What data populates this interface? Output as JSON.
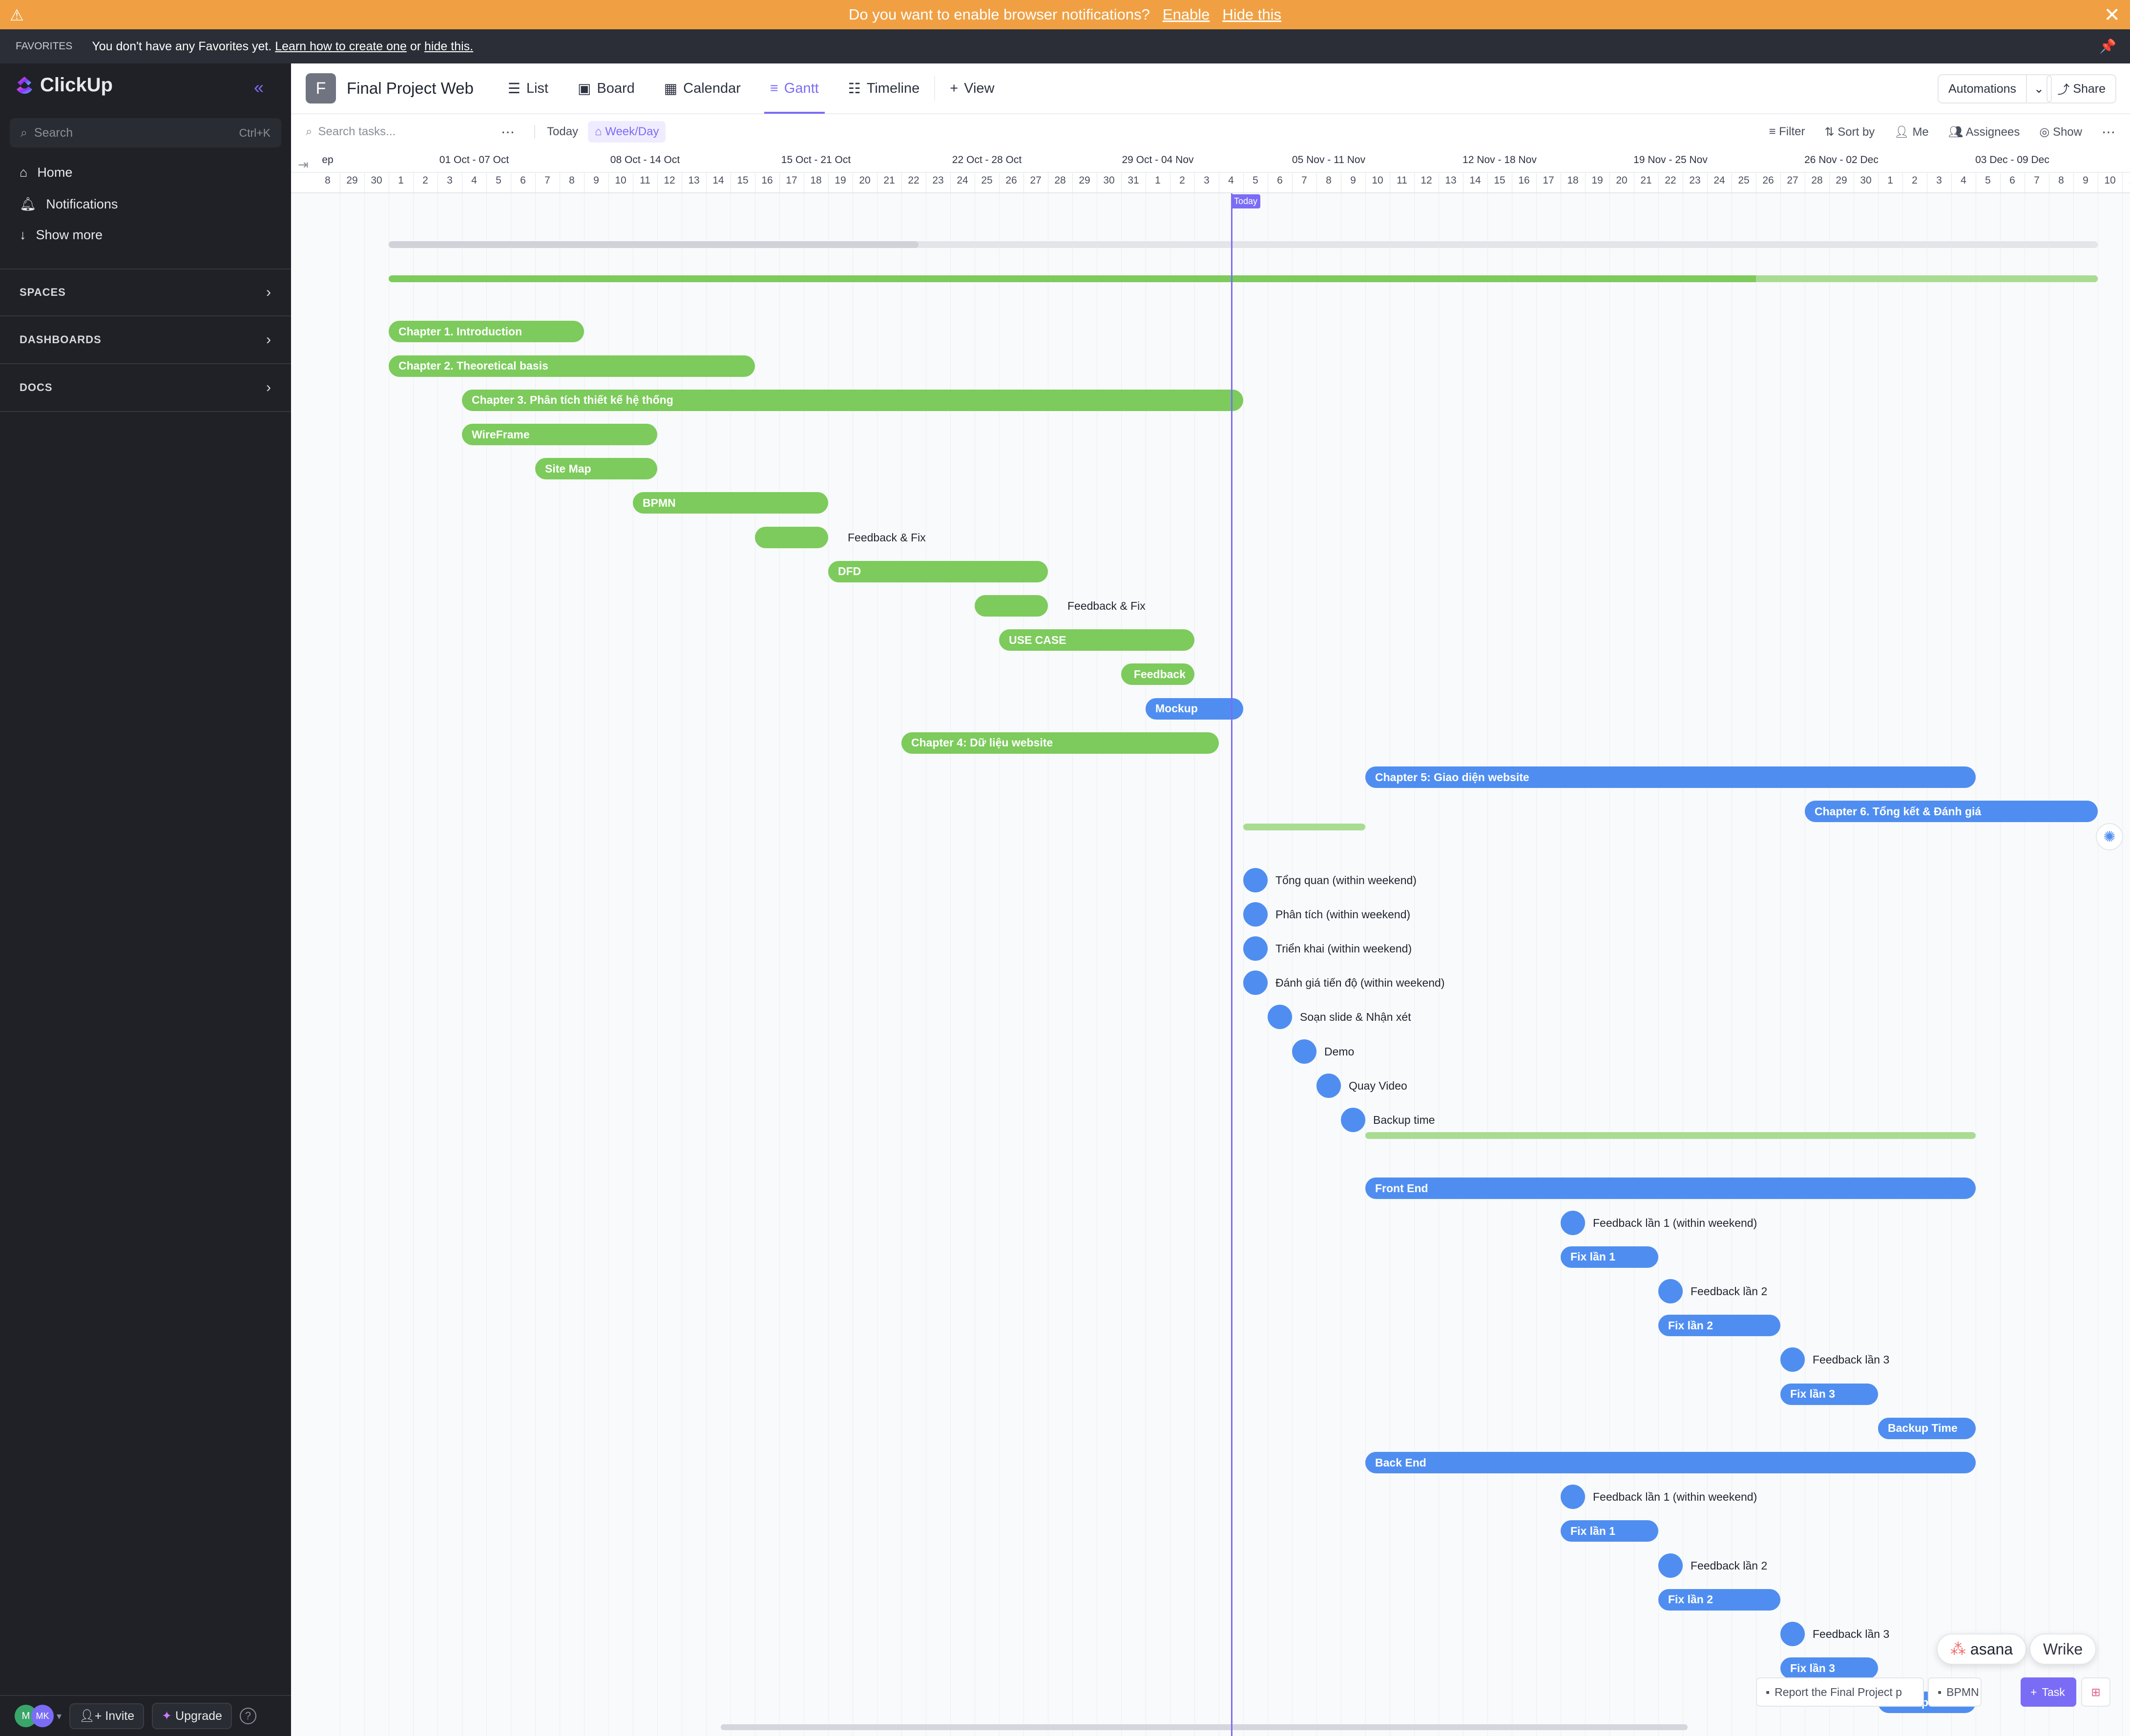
{
  "notification": {
    "prompt": "Do you want to enable browser notifications?",
    "enable": "Enable",
    "hide": "Hide this"
  },
  "favorites": {
    "label": "FAVORITES",
    "text": "You don't have any Favorites yet.",
    "link1": "Learn how to create one",
    "or": "or",
    "link2": "hide this."
  },
  "sidebar": {
    "brand": "ClickUp",
    "search_placeholder": "Search",
    "search_shortcut": "Ctrl+K",
    "nav": [
      "Home",
      "Notifications",
      "Show more"
    ],
    "sections": [
      "SPACES",
      "DASHBOARDS",
      "DOCS"
    ],
    "invite": "Invite",
    "upgrade": "Upgrade",
    "avatar1": "M",
    "avatar2": "MK"
  },
  "header": {
    "project_initial": "F",
    "project_title": "Final Project Web",
    "tabs": [
      "List",
      "Board",
      "Calendar",
      "Gantt",
      "Timeline"
    ],
    "add_view": "View",
    "automations": "Automations",
    "share": "Share"
  },
  "toolbar": {
    "search_placeholder": "Search tasks...",
    "today": "Today",
    "scale": "Week/Day",
    "filter": "Filter",
    "sort": "Sort by",
    "me": "Me",
    "assignees": "Assignees",
    "show": "Show"
  },
  "gantt": {
    "weeks": [
      "ep",
      "01 Oct - 07 Oct",
      "08 Oct - 14 Oct",
      "15 Oct - 21 Oct",
      "22 Oct - 28 Oct",
      "29 Oct - 04 Nov",
      "05 Nov - 11 Nov",
      "12 Nov - 18 Nov",
      "19 Nov - 25 Nov",
      "26 Nov - 02 Dec",
      "03 Dec - 09 Dec"
    ],
    "days": [
      "8",
      "29",
      "30",
      "1",
      "2",
      "3",
      "4",
      "5",
      "6",
      "7",
      "8",
      "9",
      "10",
      "11",
      "12",
      "13",
      "14",
      "15",
      "16",
      "17",
      "18",
      "19",
      "20",
      "21",
      "22",
      "23",
      "24",
      "25",
      "26",
      "27",
      "28",
      "29",
      "30",
      "31",
      "1",
      "2",
      "3",
      "4",
      "5",
      "6",
      "7",
      "8",
      "9",
      "10",
      "11",
      "12",
      "13",
      "14",
      "15",
      "16",
      "17",
      "18",
      "19",
      "20",
      "21",
      "22",
      "23",
      "24",
      "25",
      "26",
      "27",
      "28",
      "29",
      "30",
      "1",
      "2",
      "3",
      "4",
      "5",
      "6",
      "7",
      "8",
      "9",
      "10",
      "11"
    ],
    "today_label": "Today",
    "today_day": 37.5,
    "tasks": [
      {
        "type": "summary",
        "start": 3,
        "end": 73,
        "color": "#e3e5e9"
      },
      {
        "type": "summary",
        "start": 3,
        "end": 73,
        "color": "#7ccb5c",
        "progress": 0.8
      },
      {
        "type": "bar",
        "name": "Chapter 1. Introduction",
        "start": 3,
        "end": 11,
        "color": "green"
      },
      {
        "type": "bar",
        "name": "Chapter 2. Theoretical basis",
        "start": 3,
        "end": 18,
        "color": "green"
      },
      {
        "type": "bar",
        "name": "Chapter 3. Phân tích thiết kế hệ thống",
        "start": 6,
        "end": 38,
        "color": "green"
      },
      {
        "type": "bar",
        "name": "WireFrame",
        "start": 6,
        "end": 14,
        "color": "green"
      },
      {
        "type": "bar",
        "name": "Site Map",
        "start": 9,
        "end": 14,
        "color": "green"
      },
      {
        "type": "bar",
        "name": "BPMN",
        "start": 13,
        "end": 21,
        "color": "green"
      },
      {
        "type": "bar",
        "name": "Feedback & Fix",
        "label": "outside",
        "start": 18,
        "end": 21,
        "color": "green"
      },
      {
        "type": "bar",
        "name": "DFD",
        "start": 21,
        "end": 30,
        "color": "green"
      },
      {
        "type": "bar",
        "name": "Feedback & Fix",
        "label": "outside",
        "start": 27,
        "end": 30,
        "color": "green"
      },
      {
        "type": "bar",
        "name": "USE CASE",
        "start": 28,
        "end": 36,
        "color": "green"
      },
      {
        "type": "bar",
        "name": "Feedback",
        "start": 33,
        "end": 36,
        "color": "green",
        "align": "right"
      },
      {
        "type": "bar",
        "name": "Mockup",
        "start": 34,
        "end": 38,
        "color": "blue"
      },
      {
        "type": "bar",
        "name": "Chapter 4: Dữ liệu website",
        "start": 24,
        "end": 37,
        "color": "green"
      },
      {
        "type": "bar",
        "name": "Chapter 5: Giao diện website",
        "start": 43,
        "end": 68,
        "color": "blue"
      },
      {
        "type": "bar",
        "name": "Chapter 6. Tổng kết & Đánh giá",
        "start": 61,
        "end": 73,
        "color": "blue"
      },
      {
        "type": "summary",
        "start": 38,
        "end": 43,
        "color": "#a9dc92"
      },
      {
        "type": "dot",
        "name": "Tổng quan (within weekend)",
        "start": 38
      },
      {
        "type": "dot",
        "name": "Phân tích (within weekend)",
        "start": 38
      },
      {
        "type": "dot",
        "name": "Triển khai (within weekend)",
        "start": 38
      },
      {
        "type": "dot",
        "name": "Đánh giá tiến độ (within weekend)",
        "start": 38
      },
      {
        "type": "dot",
        "name": "Soạn slide & Nhận xét",
        "start": 39
      },
      {
        "type": "dot",
        "name": "Demo",
        "start": 40
      },
      {
        "type": "dot",
        "name": "Quay Video",
        "start": 41
      },
      {
        "type": "dot",
        "name": "Backup time",
        "start": 42
      },
      {
        "type": "summary",
        "start": 43,
        "end": 68,
        "color": "#a9dc92"
      },
      {
        "type": "bar",
        "name": "Front End",
        "start": 43,
        "end": 68,
        "color": "blue"
      },
      {
        "type": "dot",
        "name": "Feedback lần 1 (within weekend)",
        "start": 51
      },
      {
        "type": "bar",
        "name": "Fix lần 1",
        "start": 51,
        "end": 55,
        "color": "blue"
      },
      {
        "type": "dot",
        "name": "Feedback lần 2",
        "start": 55
      },
      {
        "type": "bar",
        "name": "Fix lần 2",
        "start": 55,
        "end": 60,
        "color": "blue"
      },
      {
        "type": "dot",
        "name": "Feedback lần 3",
        "start": 60
      },
      {
        "type": "bar",
        "name": "Fix lần 3",
        "start": 60,
        "end": 64,
        "color": "blue"
      },
      {
        "type": "bar",
        "name": "Backup Time",
        "start": 64,
        "end": 68,
        "color": "blue"
      },
      {
        "type": "bar",
        "name": "Back End",
        "start": 43,
        "end": 68,
        "color": "blue"
      },
      {
        "type": "dot",
        "name": "Feedback lần 1 (within weekend)",
        "start": 51
      },
      {
        "type": "bar",
        "name": "Fix lần 1",
        "start": 51,
        "end": 55,
        "color": "blue"
      },
      {
        "type": "dot",
        "name": "Feedback lần 2",
        "start": 55
      },
      {
        "type": "bar",
        "name": "Fix lần 2",
        "start": 55,
        "end": 60,
        "color": "blue"
      },
      {
        "type": "dot",
        "name": "Feedback lần 3",
        "start": 60
      },
      {
        "type": "bar",
        "name": "Fix lần 3",
        "start": 60,
        "end": 64,
        "color": "blue"
      },
      {
        "type": "bar",
        "name": "Backup Time",
        "start": 64,
        "end": 68,
        "color": "blue"
      }
    ]
  },
  "tray": {
    "item1": "Report the Final Project p",
    "item2": "BPMN",
    "task_button": "Task"
  },
  "integrations": {
    "asana": "asana",
    "wrike": "Wrike"
  },
  "colors": {
    "accent": "#7b6cf6",
    "green": "#7ccb5c",
    "blue": "#4f8ef0",
    "banner": "#f0a043"
  }
}
